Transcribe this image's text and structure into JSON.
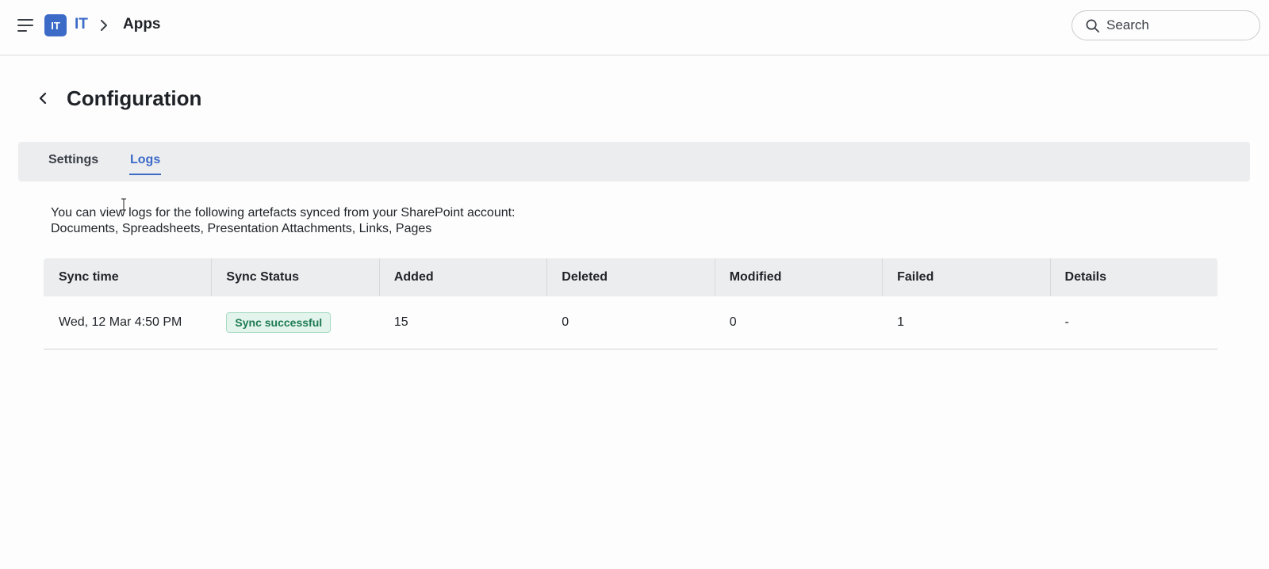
{
  "header": {
    "team_initials": "IT",
    "team_name": "IT",
    "breadcrumb_current": "Apps",
    "search_placeholder": "Search"
  },
  "page": {
    "title": "Configuration",
    "tabs": [
      {
        "label": "Settings",
        "active": false
      },
      {
        "label": "Logs",
        "active": true
      }
    ],
    "description_line1": "You can view logs for the following artefacts synced from your SharePoint account:",
    "description_line2": "Documents, Spreadsheets, Presentation Attachments, Links, Pages"
  },
  "logs_table": {
    "columns": [
      "Sync time",
      "Sync Status",
      "Added",
      "Deleted",
      "Modified",
      "Failed",
      "Details"
    ],
    "rows": [
      {
        "sync_time": "Wed, 12 Mar 4:50 PM",
        "sync_status": "Sync successful",
        "added": "15",
        "deleted": "0",
        "modified": "0",
        "failed": "1",
        "details": "-"
      }
    ]
  },
  "colors": {
    "accent": "#3c6bc7",
    "success_text": "#1d7a54",
    "success_bg": "#e3f4ec"
  },
  "icons": [
    "menu-icon",
    "chevron-right-icon",
    "search-icon",
    "chevron-left-icon"
  ]
}
